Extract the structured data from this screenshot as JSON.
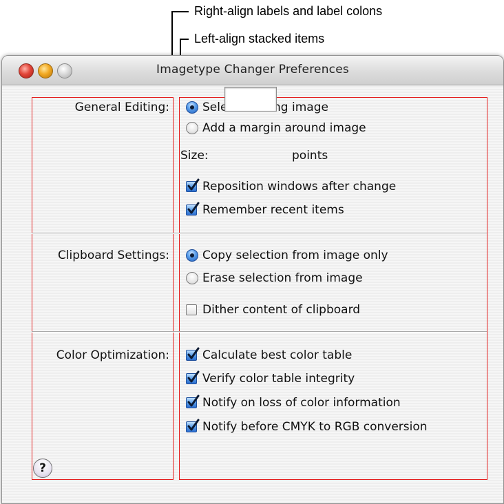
{
  "annotations": {
    "right_align": "Right-align labels and label colons",
    "left_align": "Left-align stacked items"
  },
  "window": {
    "title": "Imagetype Changer Preferences"
  },
  "sections": {
    "general": {
      "label": "General Editing:",
      "radio_select": "Select existing image",
      "radio_margin": "Add a margin around image",
      "size_label": "Size:",
      "size_value": "",
      "size_unit": "points",
      "check_reposition": "Reposition windows after change",
      "check_recent": "Remember recent items"
    },
    "clipboard": {
      "label": "Clipboard Settings:",
      "radio_copy": "Copy selection from image only",
      "radio_erase": "Erase selection from image",
      "check_dither": "Dither content of clipboard"
    },
    "color": {
      "label": "Color Optimization:",
      "check_best": "Calculate best color table",
      "check_verify": "Verify color table integrity",
      "check_loss": "Notify on loss of color information",
      "check_cmyk": "Notify before CMYK to RGB conversion"
    }
  },
  "state": {
    "general_radio_selected": "Select existing image",
    "clipboard_radio_selected": "Copy selection from image only",
    "reposition_checked": true,
    "recent_checked": true,
    "dither_checked": false,
    "best_checked": true,
    "verify_checked": true,
    "loss_checked": true,
    "cmyk_checked": true
  },
  "help": {
    "glyph": "?"
  },
  "colors": {
    "guide": "#e31b1b",
    "accent": "#2a6ccf"
  }
}
